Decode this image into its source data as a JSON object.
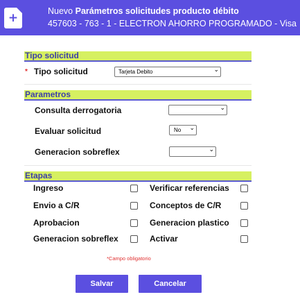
{
  "header": {
    "title_prefix": "Nuevo",
    "title_bold": "Parámetros solicitudes producto débito",
    "subtitle": "457603 - 763 - 1 - ELECTRON AHORRO PROGRAMADO - Visa",
    "icon": "new-document-icon"
  },
  "tipo_solicitud": {
    "section_title": "Tipo solicitud",
    "required_mark": "*",
    "label": "Tipo solicitud",
    "select_value": "Tarjeta Debito"
  },
  "parametros": {
    "section_title": "Parametros",
    "fields": [
      {
        "label": "Consulta derrogatoria",
        "value": ""
      },
      {
        "label": "Evaluar solicitud",
        "value": "No"
      },
      {
        "label": "Generacion sobreflex",
        "value": ""
      }
    ]
  },
  "etapas": {
    "section_title": "Etapas",
    "left": [
      {
        "label": "Ingreso",
        "checked": false
      },
      {
        "label": "Envio a C/R",
        "checked": false
      },
      {
        "label": "Aprobacion",
        "checked": false
      },
      {
        "label": "Generacion sobreflex",
        "checked": false
      }
    ],
    "right": [
      {
        "label": "Verificar referencias",
        "checked": false
      },
      {
        "label": "Conceptos de C/R",
        "checked": false
      },
      {
        "label": "Generacion plastico",
        "checked": false
      },
      {
        "label": "Activar",
        "checked": false
      }
    ]
  },
  "required_note": "*Campo obligatorio",
  "buttons": {
    "save": "Salvar",
    "cancel": "Cancelar"
  },
  "colors": {
    "header_bg": "#5b4fe0",
    "section_bg": "#d6f061",
    "section_text": "#3c3fa8",
    "required": "#e03030"
  }
}
